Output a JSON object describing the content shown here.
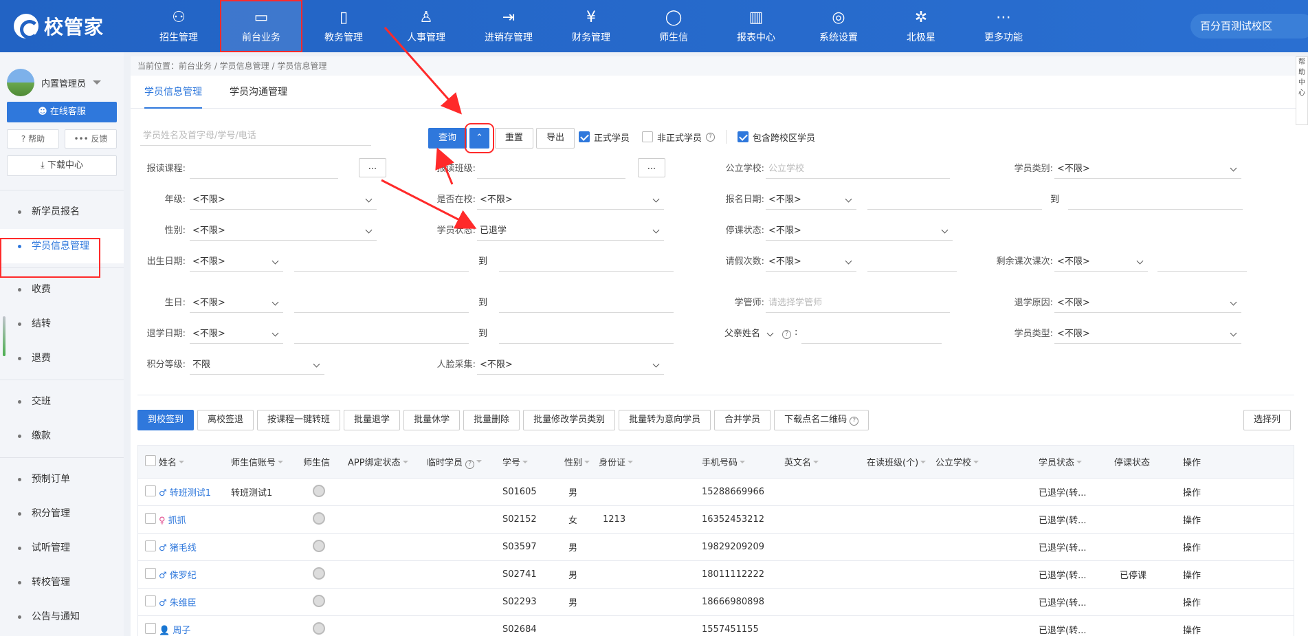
{
  "app": {
    "logo": "校管家",
    "campus": "百分百测试校区"
  },
  "nav": [
    {
      "label": "招生管理",
      "icon": "user-plus-icon"
    },
    {
      "label": "前台业务",
      "icon": "desk-icon",
      "active": true
    },
    {
      "label": "教务管理",
      "icon": "book-icon"
    },
    {
      "label": "人事管理",
      "icon": "person-icon"
    },
    {
      "label": "进销存管理",
      "icon": "inventory-icon"
    },
    {
      "label": "财务管理",
      "icon": "finance-icon"
    },
    {
      "label": "师生信",
      "icon": "chat-icon"
    },
    {
      "label": "报表中心",
      "icon": "report-icon"
    },
    {
      "label": "系统设置",
      "icon": "settings-icon"
    },
    {
      "label": "北极星",
      "icon": "star-icon"
    },
    {
      "label": "更多功能",
      "icon": "more-icon"
    }
  ],
  "sidebar": {
    "user": "内置管理员",
    "service": "在线客服",
    "help": "帮助",
    "feedback": "反馈",
    "download": "下载中心",
    "groups": [
      [
        "新学员报名",
        "学员信息管理"
      ],
      [
        "收费",
        "结转",
        "退费"
      ],
      [
        "交班",
        "缴款"
      ],
      [
        "预制订单",
        "积分管理",
        "试听管理",
        "转校管理",
        "公告与通知"
      ]
    ]
  },
  "breadcrumb": "当前位置：前台业务 / 学员信息管理 / 学员信息管理",
  "tabs": [
    "学员信息管理",
    "学员沟通管理"
  ],
  "search": {
    "placeholder": "学员姓名及首字母/学号/电话",
    "query": "查询",
    "reset": "重置",
    "export": "导出",
    "formal": "正式学员",
    "informal": "非正式学员",
    "cross": "包含跨校区学员"
  },
  "filters": {
    "course": "报读课程:",
    "class": "报读班级:",
    "school": "公立学校:",
    "school_ph": "公立学校",
    "category": "学员类别:",
    "grade": "年级:",
    "inschool": "是否在校:",
    "signup": "报名日期:",
    "to": "到",
    "gender": "性别:",
    "status": "学员状态:",
    "status_val": "已退学",
    "suspend": "停课状态:",
    "birthdate": "出生日期:",
    "leave": "请假次数:",
    "remain": "剩余课次课次:",
    "birthday": "生日:",
    "manager": "学管师:",
    "manager_ph": "请选择学管师",
    "quitreason": "退学原因:",
    "quitdate": "退学日期:",
    "father": "父亲姓名",
    "stype": "学员类型:",
    "points": "积分等级:",
    "points_val": "不限",
    "face": "人脸采集:",
    "any": "<不限>",
    "dots": "..."
  },
  "actions": [
    "到校签到",
    "离校签退",
    "按课程一键转班",
    "批量退学",
    "批量休学",
    "批量删除",
    "批量修改学员类别",
    "批量转为意向学员",
    "合并学员",
    "下载点名二维码"
  ],
  "select_cols": "选择列",
  "table": {
    "headers": [
      "姓名",
      "师生信账号",
      "师生信",
      "APP绑定状态",
      "临时学员",
      "学号",
      "性别",
      "身份证",
      "手机号码",
      "英文名",
      "在读班级(个)",
      "公立学校",
      "学员状态",
      "停课状态",
      "操作"
    ],
    "rows": [
      {
        "icon": "♂",
        "name": "转班测试1",
        "account": "转班测试1",
        "no": "S01605",
        "gender": "男",
        "id": "",
        "phone": "15288669966",
        "status": "已退学(转...",
        "suspend": "",
        "op": "操作"
      },
      {
        "icon": "♀",
        "name": "抓抓",
        "account": "",
        "no": "S02152",
        "gender": "女",
        "id": "1213",
        "phone": "16352453212",
        "status": "已退学(转...",
        "suspend": "",
        "op": "操作"
      },
      {
        "icon": "♂",
        "name": "猪毛线",
        "account": "",
        "no": "S03597",
        "gender": "男",
        "id": "",
        "phone": "19829209209",
        "status": "已退学(转...",
        "suspend": "",
        "op": "操作"
      },
      {
        "icon": "♂",
        "name": "侏罗纪",
        "account": "",
        "no": "S02741",
        "gender": "男",
        "id": "",
        "phone": "18011112222",
        "status": "已退学(转...",
        "suspend": "已停课",
        "op": "操作"
      },
      {
        "icon": "♂",
        "name": "朱维臣",
        "account": "",
        "no": "S02293",
        "gender": "男",
        "id": "",
        "phone": "18666980898",
        "status": "已退学(转...",
        "suspend": "",
        "op": "操作"
      },
      {
        "icon": "👤",
        "name": "周子",
        "account": "",
        "no": "S02684",
        "gender": "",
        "id": "",
        "phone": "1557451155",
        "status": "已退学(转...",
        "suspend": "",
        "op": "操作"
      }
    ]
  },
  "right_edge": "帮助中心"
}
